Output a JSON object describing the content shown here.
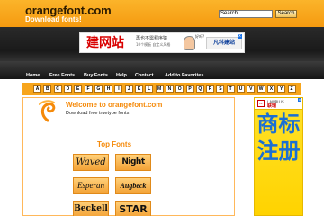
{
  "header": {
    "title": "orangefont.com",
    "subtitle": "Download fonts!",
    "search_placeholder": "Search",
    "search_button": "Search"
  },
  "top_ad": {
    "headline": "建网站",
    "line1": "再也不需程序猿",
    "line2": "10个模板 自定义风格",
    "bubble": "好吗?",
    "logo_text": "凡科建站",
    "close": "x"
  },
  "nav": {
    "items": [
      "Home",
      "Free Fonts",
      "Buy Fonts",
      "Help",
      "Contact",
      "Add to Favorites"
    ]
  },
  "alphabet": [
    "A",
    "B",
    "C",
    "D",
    "E",
    "F",
    "G",
    "H",
    "I",
    "J",
    "K",
    "L",
    "M",
    "N",
    "O",
    "P",
    "Q",
    "R",
    "S",
    "T",
    "U",
    "V",
    "W",
    "X",
    "Y",
    "Z"
  ],
  "main": {
    "welcome_title": "Welcome to orangefont.com",
    "welcome_sub": "Download free truetype fonts",
    "top_fonts_title": "Top Fonts",
    "fonts": [
      "Waved",
      "Night",
      "Esperan",
      "Augbeck",
      "Beckell",
      "STAR"
    ]
  },
  "side_ad": {
    "logo": "LP",
    "brand_small": "LAWPLUS",
    "brand": "联瑞",
    "text": "商标注册",
    "close": "x"
  },
  "colors": {
    "orange": "#f7a51c",
    "dark": "#1a1a1a",
    "accent_text": "#f58a0a",
    "side_ad_bg": "#ffd300",
    "side_ad_text": "#1a6fd4"
  }
}
